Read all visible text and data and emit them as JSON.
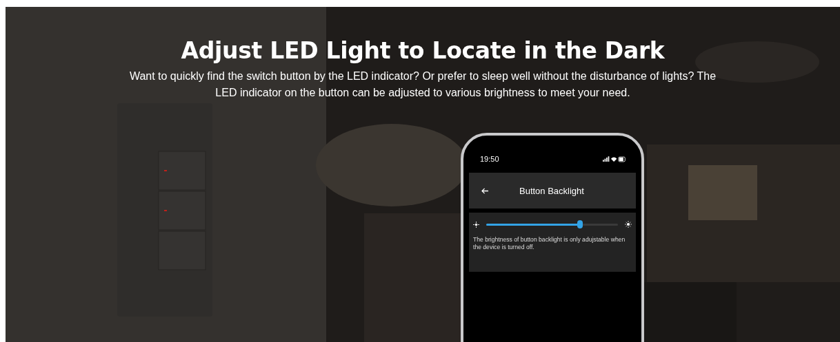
{
  "headline": "Adjust LED Light to Locate in the Dark",
  "description": "Want to quickly find the switch button by the LED indicator? Or prefer to sleep well without the disturbance of lights? The LED indicator on the button can be adjusted to various brightness to meet your need.",
  "phone": {
    "status_time": "19:50",
    "screen_title": "Button Backlight",
    "brightness_slider": {
      "level": 0.71
    },
    "note": "The brightness of button backlight is only adujstable when the device is turned off."
  }
}
